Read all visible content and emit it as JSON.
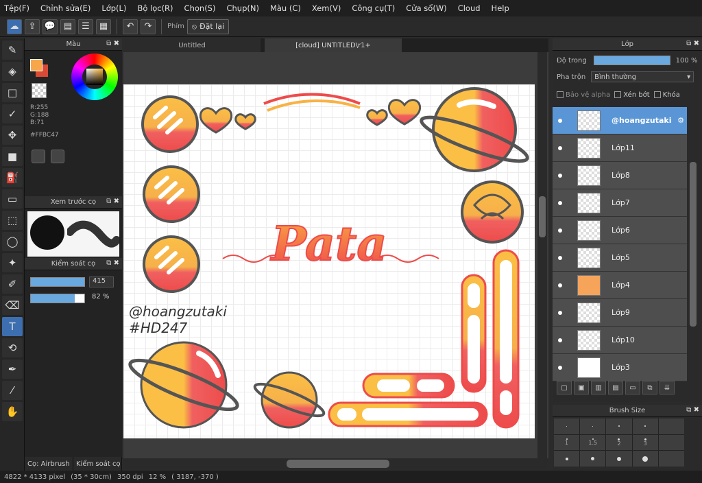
{
  "menu": [
    "Tệp(F)",
    "Chỉnh sửa(E)",
    "Lớp(L)",
    "Bộ lọc(R)",
    "Chọn(S)",
    "Chụp(N)",
    "Màu (C)",
    "Xem(V)",
    "Công cụ(T)",
    "Cửa sổ(W)",
    "Cloud",
    "Help"
  ],
  "toolbar": {
    "hotkey_label": "Phím",
    "reset_label": "Đặt lại"
  },
  "tabs": [
    "Untitled",
    "[cloud] UNTITLED\\r1+"
  ],
  "color_panel": {
    "title": "Màu",
    "rgb": [
      "R:255",
      "G:188",
      "B:71"
    ],
    "hex": "#FFBC47"
  },
  "brush_preview": {
    "title": "Xem trước cọ"
  },
  "brush_control": {
    "title": "Kiểm soát cọ",
    "size": "415",
    "opacity": "82 %"
  },
  "left_bottom_tabs": [
    "Cọ: Airbrush",
    "Kiểm soát cọ"
  ],
  "canvas": {
    "logo_text": "Pata",
    "watermark_line1": "@hoangzutaki",
    "watermark_line2": "#HD247"
  },
  "layer_panel": {
    "title": "Lớp",
    "opacity_label": "Độ trong",
    "opacity_value": "100 %",
    "blend_label": "Pha trộn",
    "blend_value": "Bình thường",
    "protect_alpha": "Bảo vệ alpha",
    "clipping": "Xén bớt",
    "lock": "Khóa",
    "layers": [
      "@hoangzutaki",
      "Lớp11",
      "Lớp8",
      "Lớp7",
      "Lớp6",
      "Lớp5",
      "Lớp4",
      "Lớp9",
      "Lớp10",
      "Lớp3"
    ]
  },
  "brush_size": {
    "title": "Brush Size",
    "labels": [
      "1",
      "1.5",
      "2",
      "3"
    ]
  },
  "status": {
    "size": "4822 * 4133 pixel",
    "cm": "(35 * 30cm)",
    "dpi": "350 dpi",
    "zoom": "12 %",
    "coords": "( 3187, -370 )"
  }
}
